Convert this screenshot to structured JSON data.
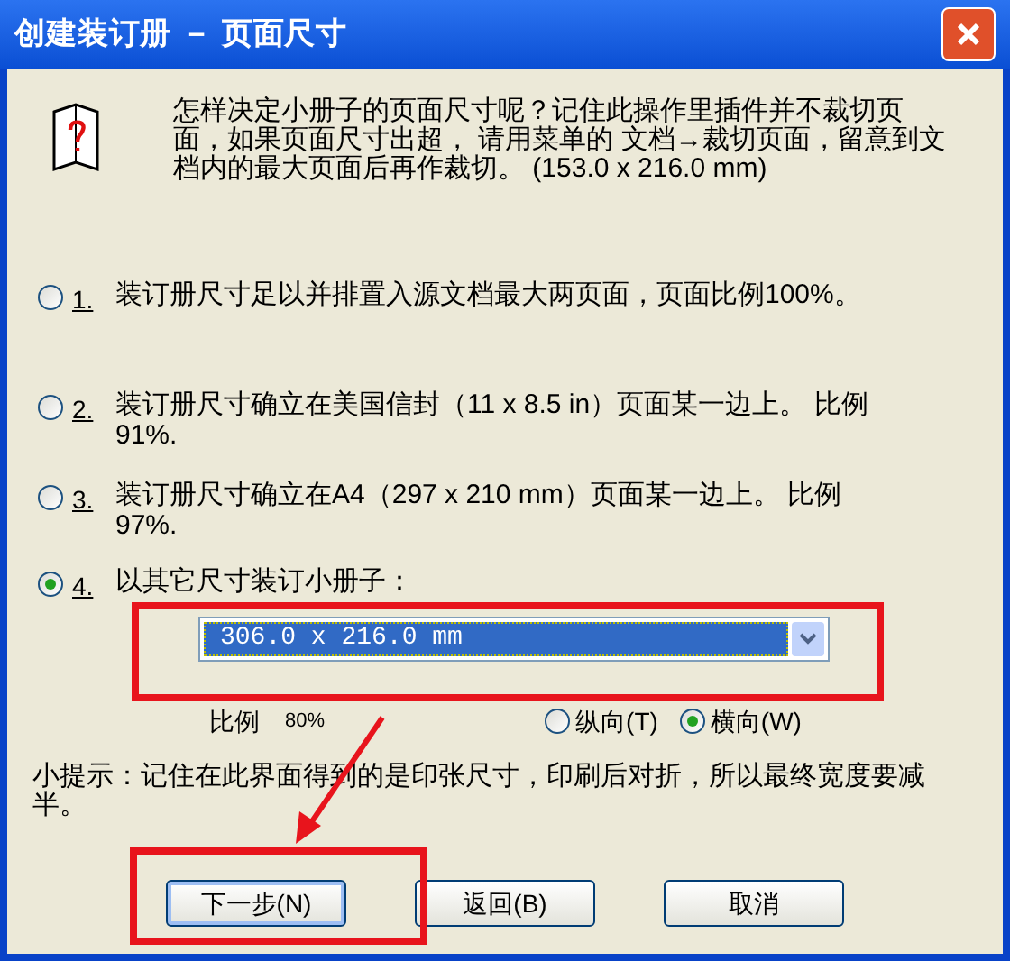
{
  "window": {
    "title": "创建装订册 － 页面尺寸"
  },
  "intro": "怎样决定小册子的页面尺寸呢？记住此操作里插件并不裁切页面，如果页面尺寸出超， 请用菜单的 文档→裁切页面，留意到文档内的最大页面后再作裁切。 (153.0 x 216.0 mm)",
  "options": [
    {
      "number": "1.",
      "label": "装订册尺寸足以并排置入源文档最大两页面，页面比例100%。",
      "selected": false
    },
    {
      "number": "2.",
      "label": "装订册尺寸确立在美国信封（11 x 8.5 in）页面某一边上。 比例  91%.",
      "selected": false
    },
    {
      "number": "3.",
      "label": "装订册尺寸确立在A4（297 x 210 mm）页面某一边上。 比例  97%.",
      "selected": false
    },
    {
      "number": "4.",
      "label": "以其它尺寸装订小册子：",
      "selected": true
    }
  ],
  "size_combo": {
    "value": "306.0 x 216.0 mm"
  },
  "scale": {
    "label": "比例",
    "value": "80%"
  },
  "orientation": [
    {
      "label": "纵向(T)",
      "selected": false
    },
    {
      "label": "横向(W)",
      "selected": true
    }
  ],
  "tip": "小提示：记住在此界面得到的是印张尺寸，印刷后对折，所以最终宽度要减半。",
  "buttons": [
    {
      "label": "下一步(N)",
      "focused": true
    },
    {
      "label": "返回(B)",
      "focused": false
    },
    {
      "label": "取消",
      "focused": false
    }
  ]
}
